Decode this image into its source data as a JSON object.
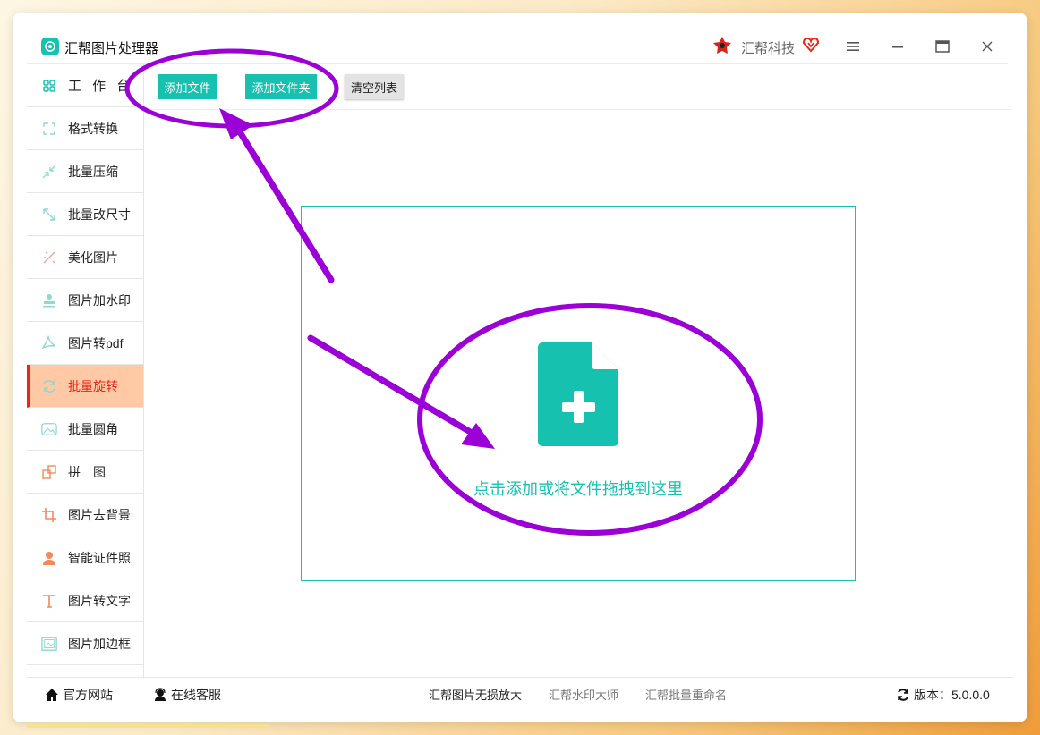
{
  "app": {
    "title": "汇帮图片处理器",
    "brand": "汇帮科技"
  },
  "sidebar": {
    "items": [
      {
        "label": "工 作 台",
        "icon": "grid-icon"
      },
      {
        "label": "格式转换",
        "icon": "convert-icon"
      },
      {
        "label": "批量压缩",
        "icon": "compress-icon"
      },
      {
        "label": "批量改尺寸",
        "icon": "resize-icon"
      },
      {
        "label": "美化图片",
        "icon": "beautify-icon"
      },
      {
        "label": "图片加水印",
        "icon": "stamp-icon"
      },
      {
        "label": "图片转pdf",
        "icon": "pdf-icon"
      },
      {
        "label": "批量旋转",
        "icon": "rotate-icon",
        "active": true
      },
      {
        "label": "批量圆角",
        "icon": "round-corner-icon"
      },
      {
        "label": "拼　图",
        "icon": "puzzle-icon"
      },
      {
        "label": "图片去背景",
        "icon": "crop-icon"
      },
      {
        "label": "智能证件照",
        "icon": "person-icon"
      },
      {
        "label": "图片转文字",
        "icon": "text-icon"
      },
      {
        "label": "图片加边框",
        "icon": "frame-icon"
      }
    ]
  },
  "toolbar": {
    "add_file": "添加文件",
    "add_folder": "添加文件夹",
    "clear_list": "清空列表"
  },
  "dropzone": {
    "text": "点击添加或将文件拖拽到这里"
  },
  "footer": {
    "website": "官方网站",
    "support": "在线客服",
    "links": [
      "汇帮图片无损放大",
      "汇帮水印大师",
      "汇帮批量重命名"
    ],
    "version_label": "版本：",
    "version": "5.0.0.0"
  },
  "colors": {
    "accent": "#17c1af",
    "active_bg": "#ffc9a6",
    "active_text": "#e5261a",
    "annotation": "#9b00d6"
  }
}
